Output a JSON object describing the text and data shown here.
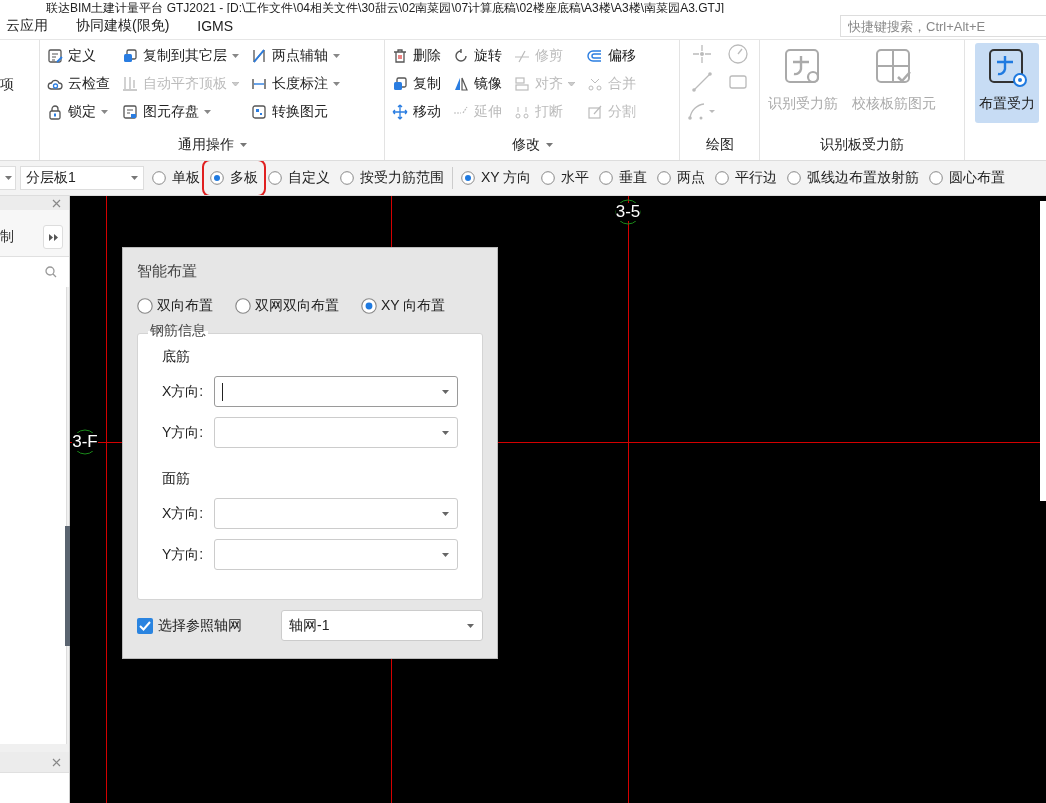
{
  "window": {
    "title": "联达BIM土建计量平台 GTJ2021 - [D:\\工作文件\\04相关文件\\30甜云\\02南菜园\\07计算底稿\\02楼座底稿\\A3楼\\A3楼\\南菜园A3.GTJ]"
  },
  "menu": [
    "云应用",
    "协同建模(限免)",
    "IGMS"
  ],
  "shortcut_search": {
    "placeholder": "快捷键搜索，Ctrl+Alt+E"
  },
  "ribbon": {
    "left_fragment": "项",
    "groups": [
      {
        "title": "通用操作",
        "kind": "small",
        "has_menu": true,
        "columns": [
          [
            {
              "label": "定义",
              "disabled": false,
              "dropdown": false
            },
            {
              "label": "云检查",
              "disabled": false,
              "dropdown": false
            },
            {
              "label": "锁定",
              "disabled": false,
              "dropdown": true
            }
          ],
          [
            {
              "label": "复制到其它层",
              "disabled": false,
              "dropdown": true
            },
            {
              "label": "自动平齐顶板",
              "disabled": true,
              "dropdown": true
            },
            {
              "label": "图元存盘",
              "disabled": false,
              "dropdown": true
            }
          ],
          [
            {
              "label": "两点辅轴",
              "disabled": false,
              "dropdown": true
            },
            {
              "label": "长度标注",
              "disabled": false,
              "dropdown": true
            },
            {
              "label": "转换图元",
              "disabled": false,
              "dropdown": false
            }
          ]
        ]
      },
      {
        "title": "修改",
        "kind": "small",
        "has_menu": true,
        "columns": [
          [
            {
              "label": "删除",
              "disabled": false,
              "dropdown": false
            },
            {
              "label": "复制",
              "disabled": false,
              "dropdown": false
            },
            {
              "label": "移动",
              "disabled": false,
              "dropdown": false
            }
          ],
          [
            {
              "label": "旋转",
              "disabled": false,
              "dropdown": false
            },
            {
              "label": "镜像",
              "disabled": false,
              "dropdown": false
            },
            {
              "label": "延伸",
              "disabled": true,
              "dropdown": false
            }
          ],
          [
            {
              "label": "修剪",
              "disabled": true,
              "dropdown": false
            },
            {
              "label": "对齐",
              "disabled": true,
              "dropdown": true
            },
            {
              "label": "打断",
              "disabled": true,
              "dropdown": false
            }
          ],
          [
            {
              "label": "偏移",
              "disabled": false,
              "dropdown": false
            },
            {
              "label": "合并",
              "disabled": true,
              "dropdown": false
            },
            {
              "label": "分割",
              "disabled": true,
              "dropdown": false
            }
          ]
        ]
      },
      {
        "title": "绘图",
        "kind": "icons",
        "has_menu": false
      },
      {
        "title": "识别板受力筋",
        "kind": "large",
        "has_menu": false,
        "buttons": [
          {
            "label": "识别受力筋",
            "disabled": true,
            "selected": false
          },
          {
            "label": "校核板筋图元",
            "disabled": true,
            "selected": false
          }
        ]
      },
      {
        "kind": "large",
        "buttons": [
          {
            "label": "布置受力",
            "disabled": false,
            "selected": true
          }
        ]
      }
    ]
  },
  "toolbar": {
    "layer": {
      "value": "分层板1"
    },
    "mode_options": [
      {
        "label": "单板",
        "selected": false,
        "highlighted": false
      },
      {
        "label": "多板",
        "selected": true,
        "highlighted": true
      },
      {
        "label": "自定义",
        "selected": false,
        "highlighted": false
      },
      {
        "label": "按受力筋范围",
        "selected": false,
        "highlighted": false
      }
    ],
    "direction_options": [
      {
        "label": "XY 方向",
        "selected": true
      },
      {
        "label": "水平",
        "selected": false
      },
      {
        "label": "垂直",
        "selected": false
      },
      {
        "label": "两点",
        "selected": false
      },
      {
        "label": "平行边",
        "selected": false
      },
      {
        "label": "弧线边布置放射筋",
        "selected": false
      },
      {
        "label": "圆心布置",
        "selected": false
      }
    ]
  },
  "side_panel": {
    "tab_fragment": "制"
  },
  "canvas": {
    "axis_labels": [
      "3-5",
      "3-F"
    ]
  },
  "dialog": {
    "title": "智能布置",
    "layout_options": [
      {
        "label": "双向布置",
        "selected": false
      },
      {
        "label": "双网双向布置",
        "selected": false
      },
      {
        "label": "XY 向布置",
        "selected": true
      }
    ],
    "group_title": "钢筋信息",
    "sections": [
      {
        "title": "底筋",
        "fields": [
          {
            "label": "X方向:",
            "focused": true
          },
          {
            "label": "Y方向:",
            "focused": false
          }
        ]
      },
      {
        "title": "面筋",
        "fields": [
          {
            "label": "X方向:",
            "focused": false
          },
          {
            "label": "Y方向:",
            "focused": false
          }
        ]
      }
    ],
    "reference_grid": {
      "label": "选择参照轴网",
      "checked": true,
      "value": "轴网-1"
    }
  }
}
